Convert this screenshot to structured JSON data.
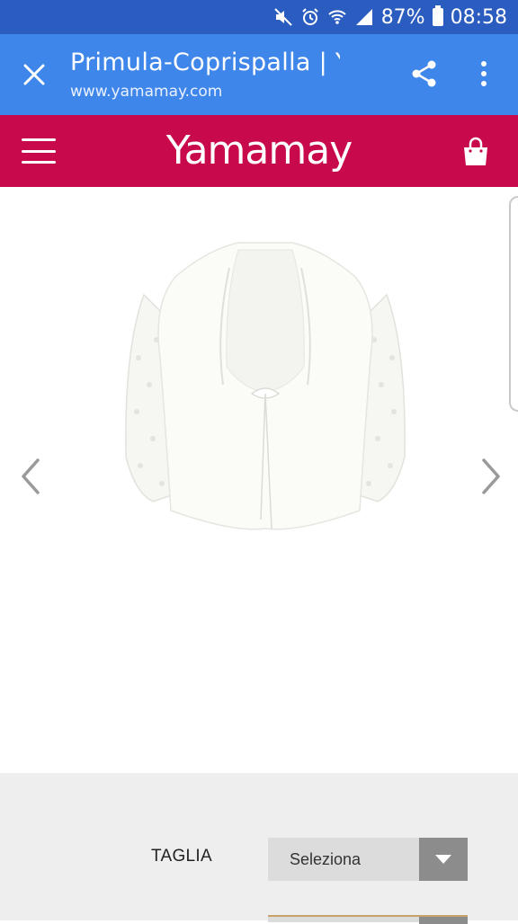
{
  "status_bar": {
    "battery_percent": "87%",
    "time": "08:58",
    "icons": [
      "mute-icon",
      "alarm-icon",
      "wifi-icon",
      "signal-icon",
      "battery-icon"
    ]
  },
  "toolbar": {
    "title": "Primula-Coprispalla | Y...",
    "url": "www.yamamay.com",
    "background": "#3f86ea",
    "status_background": "#2a5dbf"
  },
  "site_header": {
    "logo_text": "Yamamay",
    "background": "#c8094b"
  },
  "product": {
    "image_name": "white-lace-bolero-shrug",
    "prev_icon": "chevron-left-icon",
    "next_icon": "chevron-right-icon"
  },
  "options": {
    "size_label": "TAGLIA",
    "size_value": "Seleziona"
  }
}
